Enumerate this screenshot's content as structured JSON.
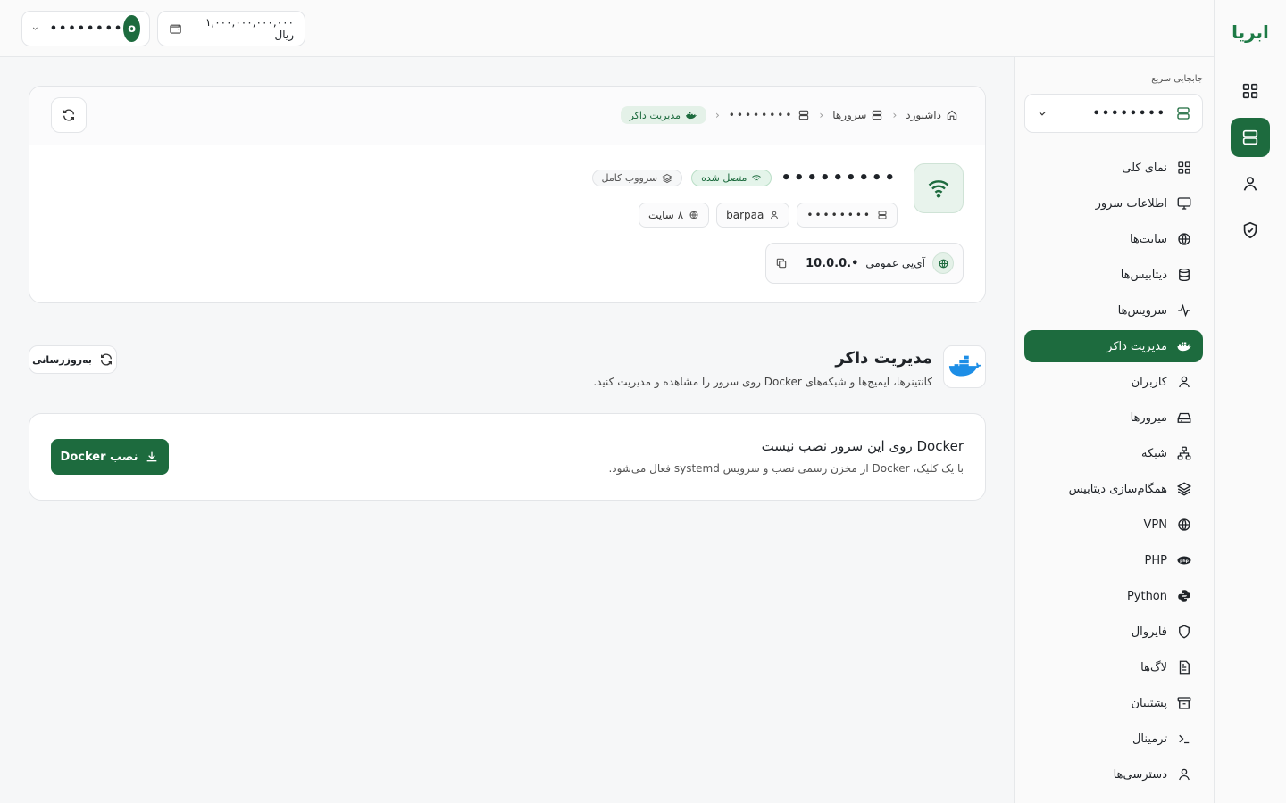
{
  "brand": {
    "logo_text": "ابریا",
    "accent": "#1d6b3e"
  },
  "topbar": {
    "user": {
      "avatar_letter": "o",
      "name": "••••••••"
    },
    "wallet": {
      "balance": "۱,۰۰۰,۰۰۰,۰۰۰,۰۰۰ ریال"
    }
  },
  "sidebar": {
    "quick_label": "جابجایی سریع",
    "quick_value": "••••••••",
    "items": [
      {
        "label": "نمای کلی",
        "icon": "grid-icon"
      },
      {
        "label": "اطلاعات سرور",
        "icon": "monitor-icon"
      },
      {
        "label": "سایت‌ها",
        "icon": "globe-icon"
      },
      {
        "label": "دیتابیس‌ها",
        "icon": "database-icon"
      },
      {
        "label": "سرویس‌ها",
        "icon": "activity-icon"
      },
      {
        "label": "مدیریت داکر",
        "icon": "docker-icon",
        "active": true
      },
      {
        "label": "کاربران",
        "icon": "user-icon"
      },
      {
        "label": "میرورها",
        "icon": "hard-drive-icon"
      },
      {
        "label": "شبکه",
        "icon": "network-icon"
      },
      {
        "label": "همگام‌سازی دیتابیس",
        "icon": "layers-icon"
      },
      {
        "label": "VPN",
        "icon": "globe-lock-icon"
      },
      {
        "label": "PHP",
        "icon": "php-icon"
      },
      {
        "label": "Python",
        "icon": "python-icon"
      },
      {
        "label": "فایروال",
        "icon": "shield-icon"
      },
      {
        "label": "لاگ‌ها",
        "icon": "file-text-icon"
      },
      {
        "label": "پشتیبان",
        "icon": "archive-icon"
      },
      {
        "label": "ترمینال",
        "icon": "terminal-icon"
      },
      {
        "label": "دسترسی‌ها",
        "icon": "user-key-icon"
      }
    ]
  },
  "breadcrumb": {
    "home": "داشبورد",
    "servers": "سرورها",
    "server": "••••••••",
    "current": "مدیریت داکر"
  },
  "server": {
    "name": "•••••••••",
    "status": "متصل شده",
    "type": "سرووب کامل",
    "chips": {
      "host": "••••••••",
      "user": "barpaa",
      "sites": "۸ سایت"
    },
    "ip_label": "آی‌پی عمومی",
    "ip_value": "10.0.0.•"
  },
  "docker": {
    "title": "مدیریت داکر",
    "subtitle": "کانتینرها، ایمیج‌ها و شبکه‌های Docker روی سرور را مشاهده و مدیریت کنید.",
    "refresh_label": "به‌روزرسانی",
    "install": {
      "title": "Docker روی این سرور نصب نیست",
      "subtitle": "با یک کلیک، Docker از مخزن رسمی نصب و سرویس systemd فعال می‌شود.",
      "button": "نصب Docker"
    }
  }
}
